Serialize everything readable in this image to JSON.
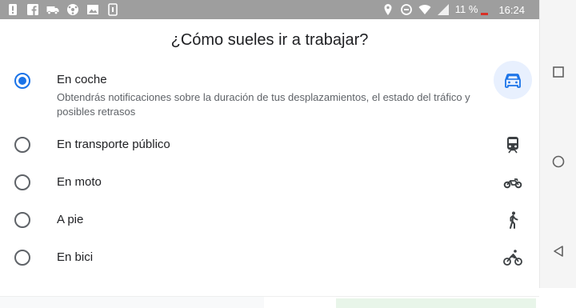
{
  "status_bar": {
    "left_icons": [
      "notification-alert-icon",
      "facebook-icon",
      "transport-icon",
      "network-icon",
      "image-icon",
      "screenshot-icon"
    ],
    "right_icons": [
      "location-icon",
      "data-saver-icon",
      "wifi-icon",
      "signal-icon"
    ],
    "battery": "11 %",
    "time": "16:24"
  },
  "sheet": {
    "title": "¿Cómo sueles ir a trabajar?",
    "options": [
      {
        "label": "En coche",
        "description": "Obtendrás notificaciones sobre la duración de tus desplazamientos, el estado del tráfico y posibles retrasos",
        "icon": "car-icon",
        "selected": true
      },
      {
        "label": "En transporte público",
        "icon": "train-icon",
        "selected": false
      },
      {
        "label": "En moto",
        "icon": "motorcycle-icon",
        "selected": false
      },
      {
        "label": "A pie",
        "icon": "walking-icon",
        "selected": false
      },
      {
        "label": "En bici",
        "icon": "bicycle-icon",
        "selected": false
      }
    ]
  },
  "nav_bar": {
    "buttons": [
      "recents-square-icon",
      "home-circle-icon",
      "back-triangle-icon"
    ]
  },
  "colors": {
    "accent": "#1a73e8",
    "status_bar": "#9e9e9e",
    "car_bubble": "#e8f0fe",
    "text": "#202124",
    "secondary_text": "#5f6368"
  }
}
